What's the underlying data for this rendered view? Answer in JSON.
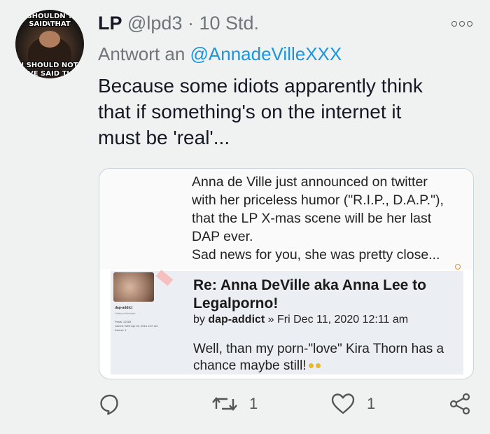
{
  "author": {
    "name": "LP",
    "handle_time": "@lpd3 · 10 Std.",
    "avatar_meme_lines": [
      "SHOULDN'T HAVE",
      "SAID THAT",
      "I SHOULD NOT",
      "HAVE SAID THAT"
    ]
  },
  "reply": {
    "prefix": "Antwort an ",
    "mention": "@AnnadeVilleXXX"
  },
  "tweet_text": "Because some  idiots apparently think\nthat if something's on the internet it\nmust be 'real'...",
  "card": {
    "quote": "Anna de Ville just announced on twitter\nwith her priceless humor (\"R.I.P., D.A.P.\"),\nthat the LP X-mas scene will be her last\nDAP ever.\nSad news for you, she was pretty close...",
    "forum": {
      "username": "dap-addict",
      "role": "Veteran Member",
      "stats": "Posts: 22283\nJoined: Wed Apr 02, 2014 1:57 am\nKarma: 1",
      "title": "Re: Anna DeVille aka Anna Lee to Legalporno!",
      "meta_by": "by ",
      "meta_user": "dap-addict",
      "meta_date": " » Fri Dec 11, 2020 12:11 am",
      "body": "Well, than my porn-\"love\" Kira Thorn has a chance maybe still!"
    }
  },
  "actions": {
    "reply_count": "",
    "retweet_count": "1",
    "like_count": "1"
  },
  "colors": {
    "accent": "#1b95e0",
    "muted": "#6f767a",
    "background": "#f0f2f2"
  }
}
